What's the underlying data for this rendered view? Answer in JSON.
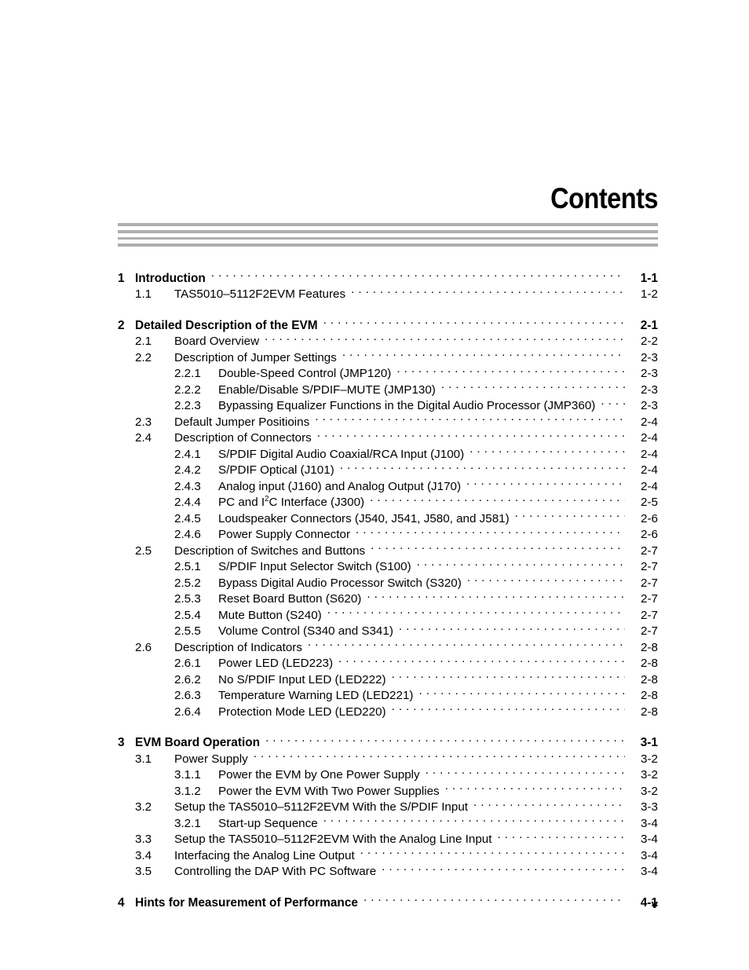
{
  "heading": "Contents",
  "folio": "v",
  "toc": {
    "entries": [
      {
        "level": 1,
        "num": "1",
        "title": "Introduction",
        "page": "1-1",
        "gap": false
      },
      {
        "level": 2,
        "num": "1.1",
        "title": "TAS5010–5112F2EVM Features",
        "page": "1-2",
        "gap": false
      },
      {
        "level": 1,
        "num": "2",
        "title": "Detailed Description of the EVM",
        "page": "2-1",
        "gap": true
      },
      {
        "level": 2,
        "num": "2.1",
        "title": "Board Overview",
        "page": "2-2",
        "gap": false
      },
      {
        "level": 2,
        "num": "2.2",
        "title": "Description of Jumper Settings",
        "page": "2-3",
        "gap": false
      },
      {
        "level": 3,
        "num": "2.2.1",
        "title": "Double-Speed Control (JMP120)",
        "page": "2-3",
        "gap": false
      },
      {
        "level": 3,
        "num": "2.2.2",
        "title": "Enable/Disable S/PDIF–MUTE (JMP130)",
        "page": "2-3",
        "gap": false
      },
      {
        "level": 3,
        "num": "2.2.3",
        "title": "Bypassing Equalizer Functions in the Digital Audio Processor (JMP360)",
        "page": "2-3",
        "gap": false
      },
      {
        "level": 2,
        "num": "2.3",
        "title": "Default Jumper Positioins",
        "page": "2-4",
        "gap": false
      },
      {
        "level": 2,
        "num": "2.4",
        "title": "Description of Connectors",
        "page": "2-4",
        "gap": false
      },
      {
        "level": 3,
        "num": "2.4.1",
        "title": "S/PDIF Digital Audio Coaxial/RCA Input (J100)",
        "page": "2-4",
        "gap": false
      },
      {
        "level": 3,
        "num": "2.4.2",
        "title": "S/PDIF Optical (J101)",
        "page": "2-4",
        "gap": false
      },
      {
        "level": 3,
        "num": "2.4.3",
        "title": "Analog input (J160) and Analog Output (J170)",
        "page": "2-4",
        "gap": false
      },
      {
        "level": 3,
        "num": "2.4.4",
        "title": "PC and I2C Interface (J300)",
        "title_html": "PC and I<sup>2</sup>C Interface (J300)",
        "page": "2-5",
        "gap": false
      },
      {
        "level": 3,
        "num": "2.4.5",
        "title": "Loudspeaker Connectors (J540, J541, J580, and J581)",
        "page": "2-6",
        "gap": false
      },
      {
        "level": 3,
        "num": "2.4.6",
        "title": "Power Supply Connector",
        "page": "2-6",
        "gap": false
      },
      {
        "level": 2,
        "num": "2.5",
        "title": "Description of Switches and Buttons",
        "page": "2-7",
        "gap": false
      },
      {
        "level": 3,
        "num": "2.5.1",
        "title": "S/PDIF Input Selector Switch (S100)",
        "page": "2-7",
        "gap": false
      },
      {
        "level": 3,
        "num": "2.5.2",
        "title": "Bypass Digital Audio Processor Switch (S320)",
        "page": "2-7",
        "gap": false
      },
      {
        "level": 3,
        "num": "2.5.3",
        "title": "Reset Board Button (S620)",
        "page": "2-7",
        "gap": false
      },
      {
        "level": 3,
        "num": "2.5.4",
        "title": "Mute Button (S240)",
        "page": "2-7",
        "gap": false
      },
      {
        "level": 3,
        "num": "2.5.5",
        "title": "Volume Control (S340 and S341)",
        "page": "2-7",
        "gap": false
      },
      {
        "level": 2,
        "num": "2.6",
        "title": "Description of Indicators",
        "page": "2-8",
        "gap": false
      },
      {
        "level": 3,
        "num": "2.6.1",
        "title": "Power LED (LED223)",
        "page": "2-8",
        "gap": false
      },
      {
        "level": 3,
        "num": "2.6.2",
        "title": "No S/PDIF Input LED (LED222)",
        "page": "2-8",
        "gap": false
      },
      {
        "level": 3,
        "num": "2.6.3",
        "title": "Temperature Warning LED (LED221)",
        "page": "2-8",
        "gap": false
      },
      {
        "level": 3,
        "num": "2.6.4",
        "title": "Protection Mode LED (LED220)",
        "page": "2-8",
        "gap": false
      },
      {
        "level": 1,
        "num": "3",
        "title": "EVM Board Operation",
        "page": "3-1",
        "gap": true
      },
      {
        "level": 2,
        "num": "3.1",
        "title": "Power Supply",
        "page": "3-2",
        "gap": false
      },
      {
        "level": 3,
        "num": "3.1.1",
        "title": "Power the EVM by One Power Supply",
        "page": "3-2",
        "gap": false
      },
      {
        "level": 3,
        "num": "3.1.2",
        "title": "Power the EVM With Two Power Supplies",
        "page": "3-2",
        "gap": false
      },
      {
        "level": 2,
        "num": "3.2",
        "title": "Setup the TAS5010–5112F2EVM With the S/PDIF Input",
        "page": "3-3",
        "gap": false
      },
      {
        "level": 3,
        "num": "3.2.1",
        "title": "Start-up Sequence",
        "page": "3-4",
        "gap": false
      },
      {
        "level": 2,
        "num": "3.3",
        "title": "Setup the TAS5010–5112F2EVM With the Analog Line Input",
        "page": "3-4",
        "gap": false
      },
      {
        "level": 2,
        "num": "3.4",
        "title": "Interfacing the Analog Line Output",
        "page": "3-4",
        "gap": false
      },
      {
        "level": 2,
        "num": "3.5",
        "title": "Controlling the DAP With PC Software",
        "page": "3-4",
        "gap": false
      },
      {
        "level": 1,
        "num": "4",
        "title": "Hints for Measurement of Performance",
        "page": "4-1",
        "gap": true
      }
    ]
  },
  "colors": {
    "rule": "#aeaeae",
    "text": "#000000",
    "background": "#ffffff"
  }
}
